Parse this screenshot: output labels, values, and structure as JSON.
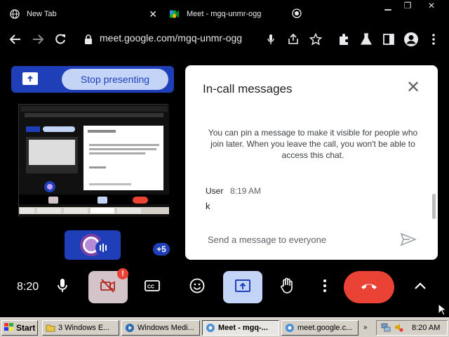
{
  "browser": {
    "tabs": [
      {
        "label": "New Tab",
        "active": false
      },
      {
        "label": "Meet - mgq-unmr-ogg",
        "active": true
      }
    ],
    "url": "meet.google.com/mgq-unmr-ogg"
  },
  "meet": {
    "stop_presenting_label": "Stop presenting",
    "participants_more": "+5",
    "clock": "8:20",
    "colors": {
      "accent": "#1f3fb8",
      "hangup": "#ea4335",
      "camera_alert": "#ea4335"
    },
    "controls": [
      "mic-icon",
      "camera-off-icon",
      "captions-icon",
      "emoji-icon",
      "present-icon",
      "raise-hand-icon",
      "more-options-icon",
      "hang-up-icon",
      "chevron-up-icon"
    ]
  },
  "chat": {
    "title": "In-call messages",
    "info": "You can pin a message to make it visible for people who join later. When you leave the call, you won't be able to access this chat.",
    "messages": [
      {
        "sender": "User",
        "time": "8:19 AM",
        "text": "k"
      }
    ],
    "input_placeholder": "Send a message to everyone"
  },
  "taskbar": {
    "start_label": "Start",
    "buttons": [
      {
        "label": "3 Windows E...",
        "active": false
      },
      {
        "label": "Windows Medi...",
        "active": false
      },
      {
        "label": "Meet - mgq-...",
        "active": true
      },
      {
        "label": "meet.google.c...",
        "active": false
      }
    ],
    "time": "8:20 AM"
  }
}
